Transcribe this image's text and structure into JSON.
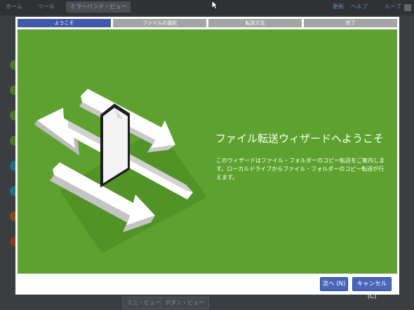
{
  "background_app": {
    "tabs": [
      "ホーム",
      "ツール",
      "ミラーバンド・ビュー"
    ],
    "right_links": [
      "更新",
      "ヘルプ",
      "ループ"
    ],
    "bottom_buttons": [
      "ミニ・ビューア",
      "ボタン・ビュー"
    ]
  },
  "wizard": {
    "steps": [
      "ようこそ",
      "ファイルの選択",
      "転送方法",
      "完了"
    ],
    "active_step": 0,
    "title": "ファイル転送ウィザードへようこそ",
    "description": "このウィザードはファイル・フォルダーのコピー転送をご案内します。ローカルドライブからファイル・フォルダーのコピー転送が行えます。",
    "buttons": {
      "next": "次へ (N)",
      "cancel": "キャンセル(C)"
    }
  },
  "colors": {
    "panel_green": "#5da22f",
    "step_active": "#3f5aa8",
    "step_inactive": "#a4a4a4",
    "button_blue": "#4a66b8"
  }
}
